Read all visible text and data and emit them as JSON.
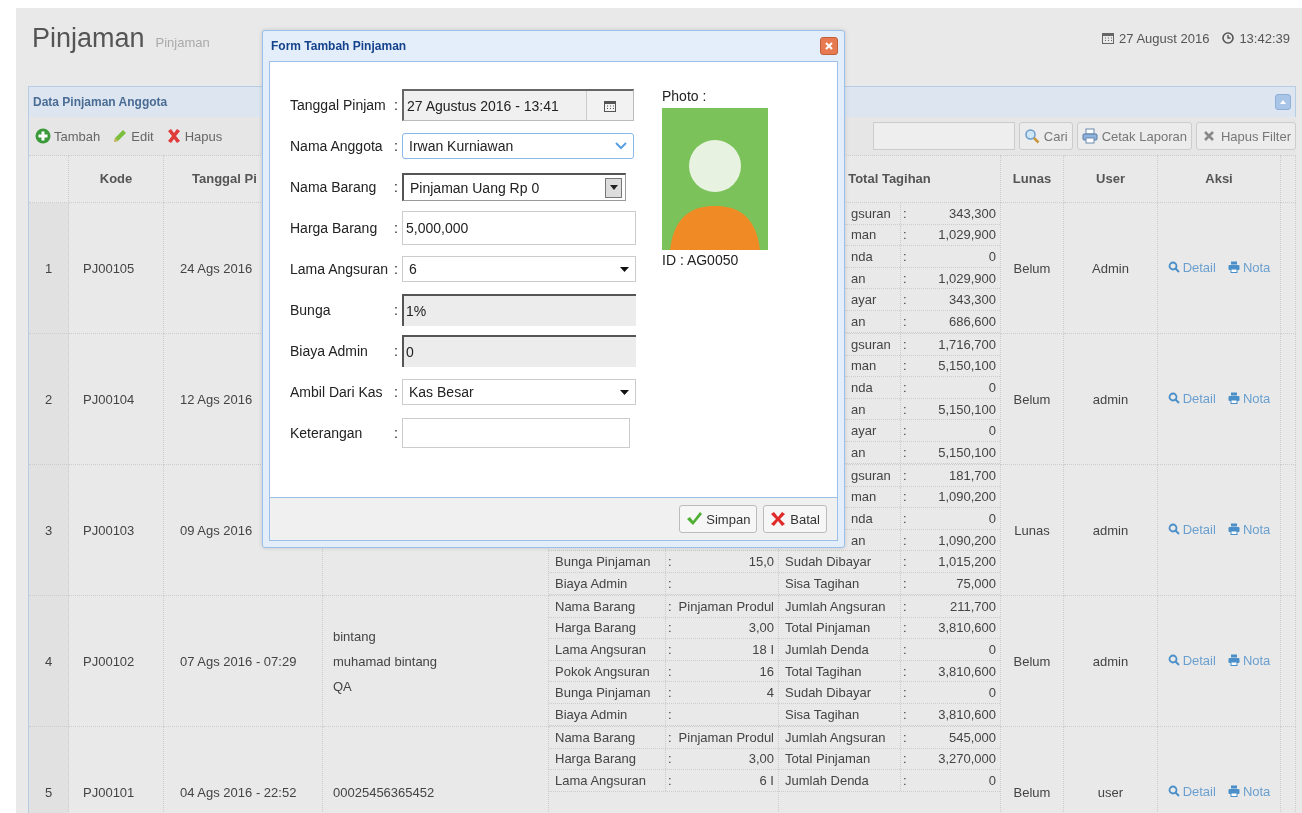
{
  "header": {
    "title": "Pinjaman",
    "subtitle": "Pinjaman",
    "date": "27 August 2016",
    "time": "13:42:39"
  },
  "panel": {
    "title": "Data Pinjaman Anggota",
    "toolbar": [
      {
        "kind": "add",
        "label": "Tambah"
      },
      {
        "kind": "edit",
        "label": "Edit"
      },
      {
        "kind": "delete",
        "label": "Hapus"
      }
    ],
    "search_buttons": [
      {
        "kind": "search",
        "label": "Cari"
      },
      {
        "kind": "print",
        "label": "Cetak Laporan"
      },
      {
        "kind": "clear",
        "label": "Hapus Filter"
      }
    ],
    "columns": [
      "",
      "Kode",
      "Tanggal Pi",
      "",
      "",
      "Total Tagihan",
      "Lunas",
      "User",
      "Aksi"
    ],
    "rows": [
      {
        "no": "1",
        "kode": "PJ00105",
        "tanggal": "24 Ags 2016",
        "anggota": [],
        "lines": [
          {
            "label_b": "gsuran",
            "sep_b": ":",
            "value_b": "343,300"
          },
          {
            "label_b": "man",
            "sep_b": ":",
            "value_b": "1,029,900"
          },
          {
            "label_b": "nda",
            "sep_b": ":",
            "value_b": "0"
          },
          {
            "label_b": "an",
            "sep_b": ":",
            "value_b": "1,029,900"
          },
          {
            "label_b": "ayar",
            "sep_b": ":",
            "value_b": "343,300"
          },
          {
            "label_b": "an",
            "sep_b": ":",
            "value_b": "686,600"
          }
        ],
        "lunas": "Belum",
        "user": "Admin",
        "actions": [
          "Detail",
          "Nota"
        ]
      },
      {
        "no": "2",
        "kode": "PJ00104",
        "tanggal": "12 Ags 2016",
        "anggota": [],
        "lines": [
          {
            "label_b": "gsuran",
            "sep_b": ":",
            "value_b": "1,716,700"
          },
          {
            "label_b": "man",
            "sep_b": ":",
            "value_b": "5,150,100"
          },
          {
            "label_b": "nda",
            "sep_b": ":",
            "value_b": "0"
          },
          {
            "label_b": "an",
            "sep_b": ":",
            "value_b": "5,150,100"
          },
          {
            "label_b": "ayar",
            "sep_b": ":",
            "value_b": "0"
          },
          {
            "label_b": "an",
            "sep_b": ":",
            "value_b": "5,150,100"
          }
        ],
        "lunas": "Belum",
        "user": "admin",
        "actions": [
          "Detail",
          "Nota"
        ]
      },
      {
        "no": "3",
        "kode": "PJ00103",
        "tanggal": "09 Ags 2016",
        "anggota": [],
        "lines": [
          {
            "label_b": "gsuran",
            "sep_b": ":",
            "value_b": "181,700"
          },
          {
            "label_b": "man",
            "sep_b": ":",
            "value_b": "1,090,200"
          },
          {
            "label_b": "nda",
            "sep_b": ":",
            "value_b": "0"
          },
          {
            "label_b": "an",
            "sep_b": ":",
            "value_b": "1,090,200"
          },
          {
            "label_a": "Bunga Pinjaman",
            "sep_a": ":",
            "value_a": "15,0",
            "label_b": "Sudah Dibayar",
            "sep_b": ":",
            "value_b": "1,015,200"
          },
          {
            "label_a": "Biaya Admin",
            "sep_a": ":",
            "label_b": "Sisa Tagihan",
            "sep_b": ":",
            "value_b": "75,000"
          }
        ],
        "lunas": "Lunas",
        "user": "admin",
        "actions": [
          "Detail",
          "Nota"
        ]
      },
      {
        "no": "4",
        "kode": "PJ00102",
        "tanggal": "07 Ags 2016 - 07:29",
        "anggota": [
          "bintang",
          "muhamad bintang",
          "QA"
        ],
        "lines": [
          {
            "label_a": "Nama Barang",
            "sep_a": ":",
            "value_a": "Pinjaman Produl",
            "label_b": "Jumlah Angsuran",
            "sep_b": ":",
            "value_b": "211,700"
          },
          {
            "label_a": "Harga Barang",
            "sep_a": ":",
            "value_a": "3,00",
            "label_b": "Total Pinjaman",
            "sep_b": ":",
            "value_b": "3,810,600"
          },
          {
            "label_a": "Lama Angsuran",
            "sep_a": ":",
            "value_a": "18 I",
            "label_b": "Jumlah Denda",
            "sep_b": ":",
            "value_b": "0"
          },
          {
            "label_a": "Pokok Angsuran",
            "sep_a": ":",
            "value_a": "16",
            "label_b": "Total Tagihan",
            "sep_b": ":",
            "value_b": "3,810,600"
          },
          {
            "label_a": "Bunga Pinjaman",
            "sep_a": ":",
            "value_a": "4",
            "label_b": "Sudah Dibayar",
            "sep_b": ":",
            "value_b": "0"
          },
          {
            "label_a": "Biaya Admin",
            "sep_a": ":",
            "label_b": "Sisa Tagihan",
            "sep_b": ":",
            "value_b": "3,810,600"
          }
        ],
        "lunas": "Belum",
        "user": "admin",
        "actions": [
          "Detail",
          "Nota"
        ]
      },
      {
        "no": "5",
        "kode": "PJ00101",
        "tanggal": "04 Ags 2016 - 22:52",
        "anggota": [
          "00025456365452"
        ],
        "lines": [
          {
            "label_a": "Nama Barang",
            "sep_a": ":",
            "value_a": "Pinjaman Produl",
            "label_b": "Jumlah Angsuran",
            "sep_b": ":",
            "value_b": "545,000"
          },
          {
            "label_a": "Harga Barang",
            "sep_a": ":",
            "value_a": "3,00",
            "label_b": "Total Pinjaman",
            "sep_b": ":",
            "value_b": "3,270,000"
          },
          {
            "label_a": "Lama Angsuran",
            "sep_a": ":",
            "value_a": "6 I",
            "label_b": "Jumlah Denda",
            "sep_b": ":",
            "value_b": "0"
          }
        ],
        "lunas": "Belum",
        "user": "user",
        "actions": [
          "Detail",
          "Nota"
        ]
      }
    ]
  },
  "dialog": {
    "title": "Form Tambah Pinjaman",
    "fields": [
      {
        "kind": "date",
        "label": "Tanggal Pinjam",
        "sep": ":",
        "value": "27 Agustus 2016 - 13:41"
      },
      {
        "kind": "combo",
        "label": "Nama Anggota",
        "sep": ":",
        "value": "Irwan Kurniawan"
      },
      {
        "kind": "listbox",
        "label": "Nama Barang",
        "sep": ":",
        "value": "Pinjaman Uang Rp 0"
      },
      {
        "kind": "text",
        "label": "Harga Barang",
        "sep": ":",
        "value": "5,000,000"
      },
      {
        "kind": "select",
        "label": "Lama Angsuran",
        "sep": ":",
        "value": "6"
      },
      {
        "kind": "readonly",
        "label": "Bunga",
        "sep": ":",
        "value": "1%"
      },
      {
        "kind": "readonly",
        "label": "Biaya Admin",
        "sep": ":",
        "value": "0"
      },
      {
        "kind": "select",
        "label": "Ambil Dari Kas",
        "sep": ":",
        "value": "Kas Besar"
      },
      {
        "kind": "text",
        "label": "Keterangan",
        "sep": ":"
      }
    ],
    "photo_label": "Photo :",
    "member_id": "ID : AG0050",
    "buttons": [
      {
        "kind": "save",
        "label": "Simpan"
      },
      {
        "kind": "cancel",
        "label": "Batal"
      }
    ]
  }
}
